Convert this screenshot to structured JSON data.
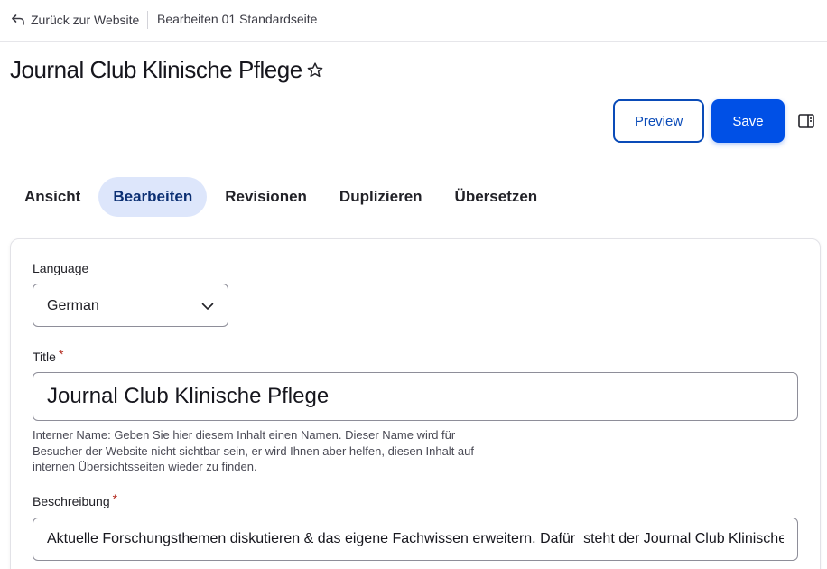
{
  "topbar": {
    "back_label": "Zurück zur Website",
    "breadcrumb": "Bearbeiten 01 Standardseite"
  },
  "page": {
    "title": "Journal Club Klinische Pflege"
  },
  "actions": {
    "preview_label": "Preview",
    "save_label": "Save"
  },
  "tabs": [
    {
      "label": "Ansicht",
      "active": false
    },
    {
      "label": "Bearbeiten",
      "active": true
    },
    {
      "label": "Revisionen",
      "active": false
    },
    {
      "label": "Duplizieren",
      "active": false
    },
    {
      "label": "Übersetzen",
      "active": false
    }
  ],
  "form": {
    "language": {
      "label": "Language",
      "value": "German"
    },
    "title": {
      "label": "Title",
      "required_mark": "*",
      "value": "Journal Club Klinische Pflege",
      "help": "Interner Name: Geben Sie hier diesem Inhalt einen Namen. Dieser Name wird für Besucher der Website nicht sichtbar sein, er wird Ihnen aber helfen, diesen Inhalt auf internen Übersichtsseiten wieder zu finden."
    },
    "description": {
      "label": "Beschreibung",
      "required_mark": "*",
      "value": "Aktuelle Forschungsthemen diskutieren & das eigene Fachwissen erweitern. Dafür  steht der Journal Club Klinische Pflege"
    }
  },
  "colors": {
    "primary": "#0050e6",
    "tab_active_bg": "#dde6fb",
    "required": "#b32a1e"
  }
}
